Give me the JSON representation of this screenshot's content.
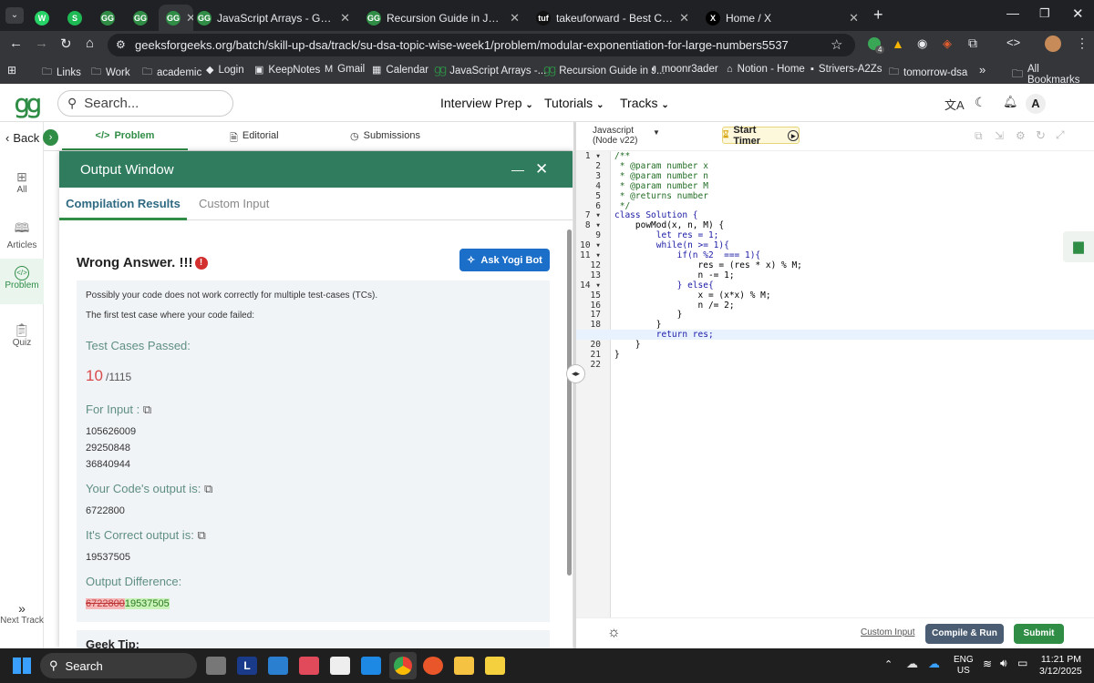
{
  "browser": {
    "tabs": [
      {
        "title": "",
        "favicon": "W",
        "color": "#25d366"
      },
      {
        "title": "",
        "favicon": "S",
        "color": "#1db954"
      },
      {
        "title": "",
        "favicon": "GG",
        "color": "#2f8d46"
      },
      {
        "title": "",
        "favicon": "GG",
        "color": "#2f8d46"
      },
      {
        "title": "",
        "favicon": "GG",
        "color": "#2f8d46"
      },
      {
        "title": "JavaScript Arrays - GeeksforGee",
        "favicon": "GG",
        "color": "#2f8d46"
      },
      {
        "title": "Recursion Guide in JavaScript -",
        "favicon": "GG",
        "color": "#2f8d46"
      },
      {
        "title": "takeuforward - Best Coding Tut",
        "favicon": "tuf",
        "color": "#111"
      },
      {
        "title": "Home / X",
        "favicon": "X",
        "color": "#000"
      }
    ],
    "url": "geeksforgeeks.org/batch/skill-up-dsa/track/su-dsa-topic-wise-week1/problem/modular-exponentiation-for-large-numbers5537",
    "bookmarks": [
      "Links",
      "Work",
      "academic",
      "Login",
      "KeepNotes",
      "Gmail",
      "Calendar",
      "JavaScript Arrays -...",
      "Recursion Guide in J...",
      "moonr3ader",
      "Notion - Home",
      "Strivers-A2Zs",
      "tomorrow-dsa"
    ],
    "all_bookmarks": "All Bookmarks",
    "extension_badge": "4"
  },
  "header": {
    "search_placeholder": "Search...",
    "nav": [
      "Interview Prep",
      "Tutorials",
      "Tracks"
    ],
    "avatar": "A"
  },
  "rail": {
    "back": "Back",
    "items": [
      "All",
      "Articles",
      "Problem",
      "Quiz"
    ],
    "next": "Next Track"
  },
  "problem_tabs": [
    "Problem",
    "Editorial",
    "Submissions"
  ],
  "output": {
    "title": "Output Window",
    "tabs": [
      "Compilation Results",
      "Custom Input"
    ],
    "verdict": "Wrong Answer. !!!",
    "ask_bot": "Ask Yogi Bot",
    "msg1": "Possibly your code does not work correctly for multiple test-cases (TCs).",
    "msg2": "The first test case where your code failed:",
    "passed_label": "Test Cases Passed:",
    "passed": "10",
    "total": "/1115",
    "input_label": "For Input :",
    "inputs": [
      "105626009",
      "29250848",
      "36840944"
    ],
    "your_label": "Your Code's output is:",
    "your_output": "6722800",
    "correct_label": "It's Correct output is:",
    "correct_output": "19537505",
    "diff_label": "Output Difference:",
    "diff_wrong": "6722800",
    "diff_right": "19537505",
    "tip": "Geek Tip:"
  },
  "editor": {
    "language": "Javascript",
    "language_version": "(Node v22)",
    "timer": "Start Timer",
    "lines": [
      "/**",
      " * @param number x",
      " * @param number n",
      " * @param number M",
      " * @returns number",
      " */",
      "class Solution {",
      "    powMod(x, n, M) {",
      "        let res = 1;",
      "        while(n >= 1){",
      "            if(n %2  === 1){",
      "                res = (res * x) % M;",
      "                n -= 1;",
      "            } else{",
      "                x = (x*x) % M;",
      "                n /= 2;",
      "            }",
      "        }",
      "        return res;",
      "    }",
      "}",
      ""
    ],
    "custom_input": "Custom Input",
    "compile": "Compile & Run",
    "submit": "Submit"
  },
  "taskbar": {
    "search": "Search",
    "lang1": "ENG",
    "lang2": "US",
    "time": "11:21 PM",
    "date": "3/12/2025"
  }
}
